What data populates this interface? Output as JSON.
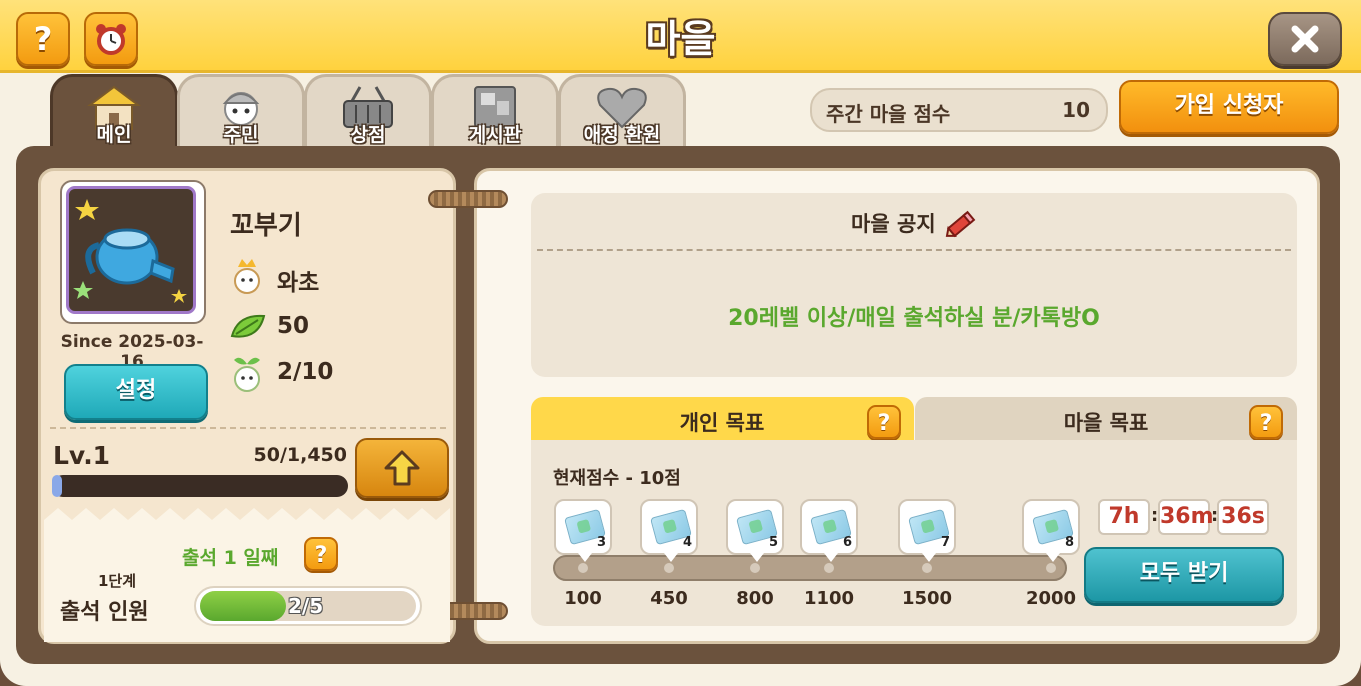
{
  "window": {
    "title": "마을"
  },
  "header": {
    "help_label": "?",
    "weekly_score_label": "주간 마을 점수",
    "weekly_score_value": "10",
    "applicants_button": "가입 신청자"
  },
  "tabs": [
    {
      "label": "메인",
      "icon": "house-icon",
      "active": true
    },
    {
      "label": "주민",
      "icon": "resident-icon",
      "active": false
    },
    {
      "label": "상점",
      "icon": "basket-icon",
      "active": false
    },
    {
      "label": "게시판",
      "icon": "board-icon",
      "active": false
    },
    {
      "label": "애정 환원",
      "icon": "heart-icon",
      "active": false
    }
  ],
  "profile": {
    "village_name": "꼬부기",
    "since": "Since 2025-03-16",
    "settings_button": "설정",
    "leader": "와초",
    "leaf_points": "50",
    "residents": "2/10",
    "level": "Lv.1",
    "exp": "50/1,450",
    "exp_fraction": 0.034
  },
  "attendance": {
    "day_label": "출석 1 일째",
    "stage": "1단계",
    "label": "출석 인원",
    "progress": "2/5",
    "progress_fraction": 0.4
  },
  "notice": {
    "title": "마을 공지",
    "text": "20레벨 이상/매일 출석하실 분/카톡방O"
  },
  "goals": {
    "tab_personal": "개인 목표",
    "tab_village": "마을 목표",
    "current_score": "현재점수 - 10점",
    "rewards": [
      {
        "count": "3",
        "threshold": "100"
      },
      {
        "count": "4",
        "threshold": "450"
      },
      {
        "count": "5",
        "threshold": "800"
      },
      {
        "count": "6",
        "threshold": "1100"
      },
      {
        "count": "7",
        "threshold": "1500"
      },
      {
        "count": "8",
        "threshold": "2000"
      }
    ],
    "timer": {
      "hours": "7h",
      "minutes": "36m",
      "seconds": "36s"
    },
    "claim_all_button": "모두 받기"
  }
}
